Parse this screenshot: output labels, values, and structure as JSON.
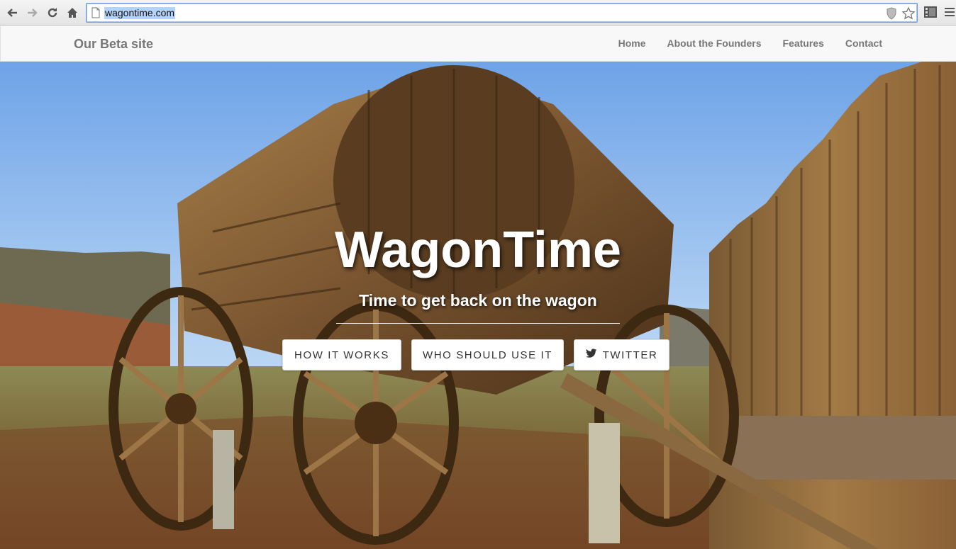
{
  "browser": {
    "url": "wagontime.com",
    "icons": [
      "back-icon",
      "forward-icon",
      "reload-icon",
      "home-icon",
      "page-icon",
      "shield-icon",
      "star-icon",
      "extensions-icon",
      "menu-icon"
    ]
  },
  "navbar": {
    "brand": "Our Beta site",
    "links": [
      "Home",
      "About the Founders",
      "Features",
      "Contact"
    ]
  },
  "hero": {
    "title": "WagonTime",
    "subtitle": "Time to get back on the wagon",
    "buttons": [
      "HOW IT WORKS",
      "WHO SHOULD USE IT",
      "TWITTER"
    ]
  },
  "colors": {
    "navbar_bg": "#f8f8f8",
    "nav_text": "#777777",
    "url_highlight": "#b3d3fb",
    "button_bg": "#ffffff"
  }
}
